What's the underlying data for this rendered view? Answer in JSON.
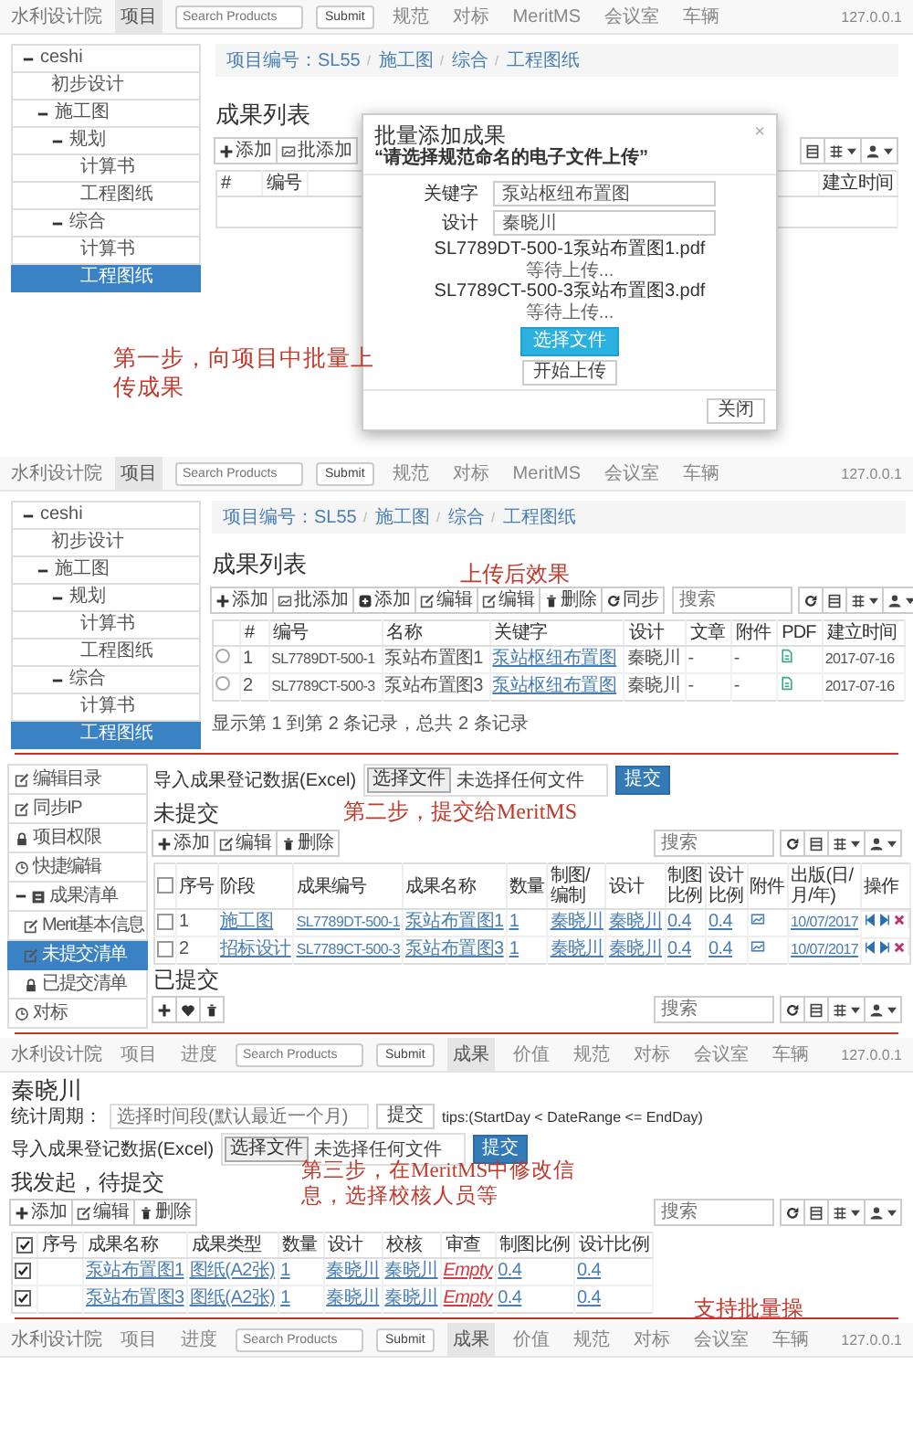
{
  "step1": {
    "navbar": {
      "brand": "水利设计院",
      "items": [
        {
          "label": "项目",
          "selected": true
        }
      ],
      "search": {
        "placeholder": "Search Products"
      },
      "submit": "Submit",
      "links": [
        {
          "label": "规范",
          "selected": false
        },
        {
          "label": "对标",
          "selected": false
        },
        {
          "label": "MeritMS",
          "selected": false
        },
        {
          "label": "会议室",
          "selected": false
        },
        {
          "label": "车辆",
          "selected": false
        }
      ],
      "host": "127.0.0.1"
    },
    "tree": [
      {
        "label": "ceshi",
        "selected": false,
        "expanded": true,
        "children": [
          {
            "label": "初步设计",
            "selected": false
          },
          {
            "label": "施工图",
            "selected": false,
            "expanded": true,
            "children": [
              {
                "label": "规划",
                "selected": false,
                "expanded": true,
                "children": [
                  {
                    "label": "计算书",
                    "selected": false
                  },
                  {
                    "label": "工程图纸",
                    "selected": false
                  }
                ]
              },
              {
                "label": "综合",
                "selected": false,
                "expanded": true,
                "children": [
                  {
                    "label": "计算书",
                    "selected": false
                  },
                  {
                    "label": "工程图纸",
                    "selected": true
                  }
                ]
              }
            ]
          }
        ]
      }
    ],
    "breadcrumb": [
      "项目编号：SL55",
      "施工图",
      "综合",
      "工程图纸"
    ],
    "heading": "成果列表",
    "toolbar": [
      {
        "kind": "add",
        "label": "添加"
      },
      {
        "kind": "batch",
        "label": "批添加"
      }
    ],
    "table": {
      "columns": [
        {
          "label": "#"
        },
        {
          "label": "编号"
        }
      ],
      "trailing_columns": [
        "建立时间"
      ]
    },
    "modal": {
      "title": "批量添加成果",
      "subtitle": "“请选择规范命名的电子文件上传”",
      "close": "×",
      "fields": [
        {
          "label": "关键字",
          "value": "泵站枢纽布置图"
        },
        {
          "label": "设计",
          "value": "秦晓川"
        }
      ],
      "files": [
        {
          "name": "SL7789DT-500-1泵站布置图1.pdf",
          "status": "等待上传..."
        },
        {
          "name": "SL7789CT-500-3泵站布置图3.pdf",
          "status": "等待上传..."
        }
      ],
      "choose_button": "选择文件",
      "upload_button": "开始上传",
      "close_button": "关闭"
    },
    "annotation": "第一步，向项目中批量上传成果"
  },
  "step2": {
    "navbar": {
      "brand": "水利设计院",
      "items": [
        {
          "label": "项目",
          "selected": true
        }
      ],
      "search": {
        "placeholder": "Search Products"
      },
      "submit": "Submit",
      "links": [
        {
          "label": "规范",
          "selected": false
        },
        {
          "label": "对标",
          "selected": false
        },
        {
          "label": "MeritMS",
          "selected": false
        },
        {
          "label": "会议室",
          "selected": false
        },
        {
          "label": "车辆",
          "selected": false
        }
      ],
      "host": "127.0.0.1"
    },
    "tree": [
      {
        "label": "ceshi",
        "selected": false,
        "expanded": true,
        "children": [
          {
            "label": "初步设计",
            "selected": false
          },
          {
            "label": "施工图",
            "selected": false,
            "expanded": true,
            "children": [
              {
                "label": "规划",
                "selected": false,
                "expanded": true,
                "children": [
                  {
                    "label": "计算书",
                    "selected": false
                  },
                  {
                    "label": "工程图纸",
                    "selected": false
                  }
                ]
              },
              {
                "label": "综合",
                "selected": false,
                "expanded": true,
                "children": [
                  {
                    "label": "计算书",
                    "selected": false
                  },
                  {
                    "label": "工程图纸",
                    "selected": true
                  }
                ]
              }
            ]
          }
        ]
      }
    ],
    "breadcrumb": [
      "项目编号：SL55",
      "施工图",
      "综合",
      "工程图纸"
    ],
    "heading": "成果列表",
    "annotation": "上传后效果",
    "toolbar": [
      {
        "kind": "add",
        "label": "添加"
      },
      {
        "kind": "batch",
        "label": "批添加"
      },
      {
        "kind": "add-box",
        "label": "添加"
      },
      {
        "kind": "edit",
        "label": "编辑"
      },
      {
        "kind": "edit",
        "label": "编辑"
      },
      {
        "kind": "delete",
        "label": "删除"
      },
      {
        "kind": "sync",
        "label": "同步"
      }
    ],
    "search": {
      "placeholder": "搜索"
    },
    "table": {
      "columns": [
        {
          "kind": "radio"
        },
        {
          "kind": "text",
          "label": "#"
        },
        {
          "kind": "code",
          "label": "编号"
        },
        {
          "kind": "text",
          "label": "名称"
        },
        {
          "kind": "link",
          "label": "关键字"
        },
        {
          "kind": "text",
          "label": "设计"
        },
        {
          "kind": "text",
          "label": "文章"
        },
        {
          "kind": "text",
          "label": "附件"
        },
        {
          "kind": "pdf",
          "label": "PDF"
        },
        {
          "kind": "date",
          "label": "建立时间"
        }
      ],
      "rows": [
        {
          "selected": false,
          "cells": [
            null,
            "1",
            "SL7789DT-500-1",
            "泵站布置图1",
            "泵站枢纽布置图",
            "秦晓川",
            "-",
            "-",
            true,
            "2017-07-16"
          ]
        },
        {
          "selected": false,
          "cells": [
            null,
            "2",
            "SL7789CT-500-3",
            "泵站布置图3",
            "泵站枢纽布置图",
            "秦晓川",
            "-",
            "-",
            true,
            "2017-07-16"
          ]
        }
      ]
    },
    "footer": "显示第 1 到第 2 条记录，总共 2 条记录"
  },
  "step3": {
    "menu": [
      {
        "kind": "edit",
        "label": "编辑目录",
        "selected": false
      },
      {
        "kind": "edit",
        "label": "同步IP",
        "selected": false
      },
      {
        "kind": "lock",
        "label": "项目权限",
        "selected": false
      },
      {
        "kind": "clock",
        "label": "快捷编辑",
        "selected": false
      },
      {
        "kind": "group",
        "label": "成果清单",
        "selected": false,
        "expanded": true,
        "children": [
          {
            "kind": "edit",
            "label": "Merit基本信息",
            "selected": false
          },
          {
            "kind": "edit",
            "label": "未提交清单",
            "selected": true
          },
          {
            "kind": "lock",
            "label": "已提交清单",
            "selected": false
          }
        ]
      },
      {
        "kind": "clock",
        "label": "对标",
        "selected": false
      }
    ],
    "import": {
      "label": "导入成果登记数据(Excel)",
      "choose": "选择文件",
      "file": "未选择任何文件",
      "submit": "提交"
    },
    "pending": {
      "heading": "未提交",
      "annotation": "第二步，提交给MeritMS",
      "toolbar": [
        {
          "kind": "add",
          "label": "添加"
        },
        {
          "kind": "edit",
          "label": "编辑"
        },
        {
          "kind": "delete",
          "label": "删除"
        }
      ],
      "search": {
        "placeholder": "搜索"
      },
      "table": {
        "all_checked": false,
        "columns": [
          {
            "kind": "check"
          },
          {
            "kind": "text",
            "label": "序号"
          },
          {
            "kind": "link",
            "label": "阶段"
          },
          {
            "kind": "code-link",
            "label": "成果编号"
          },
          {
            "kind": "link",
            "label": "成果名称"
          },
          {
            "kind": "link",
            "label": "数量"
          },
          {
            "kind": "link",
            "label": "制图/编制"
          },
          {
            "kind": "link",
            "label": "设计"
          },
          {
            "kind": "link",
            "label": "制图比例"
          },
          {
            "kind": "link",
            "label": "设计比例"
          },
          {
            "kind": "attach",
            "label": "附件"
          },
          {
            "kind": "date-link",
            "label": "出版(日/月/年)"
          },
          {
            "kind": "actions",
            "label": "操作"
          }
        ],
        "rows": [
          {
            "checked": false,
            "cells": [
              null,
              "1",
              "施工图",
              "SL7789DT-500-1",
              "泵站布置图1",
              "1",
              "秦晓川",
              "秦晓川",
              "0.4",
              "0.4",
              true,
              "10/07/2017",
              true
            ]
          },
          {
            "checked": false,
            "cells": [
              null,
              "2",
              "招标设计",
              "SL7789CT-500-3",
              "泵站布置图3",
              "1",
              "秦晓川",
              "秦晓川",
              "0.4",
              "0.4",
              true,
              "10/07/2017",
              true
            ]
          }
        ]
      }
    },
    "submitted": {
      "heading": "已提交",
      "toolbar": [
        {
          "kind": "plus"
        },
        {
          "kind": "heart"
        },
        {
          "kind": "trash"
        }
      ],
      "search": {
        "placeholder": "搜索"
      }
    }
  },
  "step4": {
    "navbar": {
      "brand": "水利设计院",
      "items": [
        {
          "label": "项目",
          "selected": false
        },
        {
          "label": "进度",
          "selected": false
        }
      ],
      "search": {
        "placeholder": "Search Products"
      },
      "submit": "Submit",
      "links": [
        {
          "label": "成果",
          "selected": true
        },
        {
          "label": "价值",
          "selected": false
        },
        {
          "label": "规范",
          "selected": false
        },
        {
          "label": "对标",
          "selected": false
        },
        {
          "label": "会议室",
          "selected": false
        },
        {
          "label": "车辆",
          "selected": false
        }
      ],
      "host": "127.0.0.1"
    },
    "title": "秦晓川",
    "period": {
      "label": "统计周期：",
      "placeholder": "选择时间段(默认最近一个月)",
      "button": "提交",
      "tips": "tips:(StartDay < DateRange <= EndDay)"
    },
    "import": {
      "label": "导入成果登记数据(Excel)",
      "choose": "选择文件",
      "file": "未选择任何文件",
      "submit": "提交"
    },
    "heading": "我发起，待提交",
    "annotation": "第三步，在MeritMS中修改信息，选择校核人员等",
    "toolbar": [
      {
        "kind": "add",
        "label": "添加"
      },
      {
        "kind": "edit",
        "label": "编辑"
      },
      {
        "kind": "delete",
        "label": "删除"
      }
    ],
    "search": {
      "placeholder": "搜索"
    },
    "table": {
      "all_checked": true,
      "columns": [
        {
          "kind": "check"
        },
        {
          "kind": "text",
          "label": "序号"
        },
        {
          "kind": "link",
          "label": "成果名称"
        },
        {
          "kind": "link",
          "label": "成果类型"
        },
        {
          "kind": "link",
          "label": "数量"
        },
        {
          "kind": "link",
          "label": "设计"
        },
        {
          "kind": "link",
          "label": "校核"
        },
        {
          "kind": "empty-link",
          "label": "审查"
        },
        {
          "kind": "link",
          "label": "制图比例"
        },
        {
          "kind": "link",
          "label": "设计比例"
        }
      ],
      "rows": [
        {
          "checked": true,
          "cells": [
            null,
            null,
            "泵站布置图1",
            "图纸(A2张)",
            "1",
            "秦晓川",
            "秦晓川",
            "Empty",
            "0.4",
            "0.4"
          ]
        },
        {
          "checked": true,
          "cells": [
            null,
            null,
            "泵站布置图3",
            "图纸(A2张)",
            "1",
            "秦晓川",
            "秦晓川",
            "Empty",
            "0.4",
            "0.4"
          ]
        }
      ]
    },
    "table_annotation": "支持批量操",
    "navbar_bottom": {
      "brand": "水利设计院",
      "items": [
        {
          "label": "项目",
          "selected": false
        },
        {
          "label": "进度",
          "selected": false
        }
      ],
      "search": {
        "placeholder": "Search Products"
      },
      "submit": "Submit",
      "links": [
        {
          "label": "成果",
          "selected": true
        },
        {
          "label": "价值",
          "selected": false
        },
        {
          "label": "规范",
          "selected": false
        },
        {
          "label": "对标",
          "selected": false
        },
        {
          "label": "会议室",
          "selected": false
        },
        {
          "label": "车辆",
          "selected": false
        }
      ],
      "host": "127.0.0.1"
    }
  }
}
